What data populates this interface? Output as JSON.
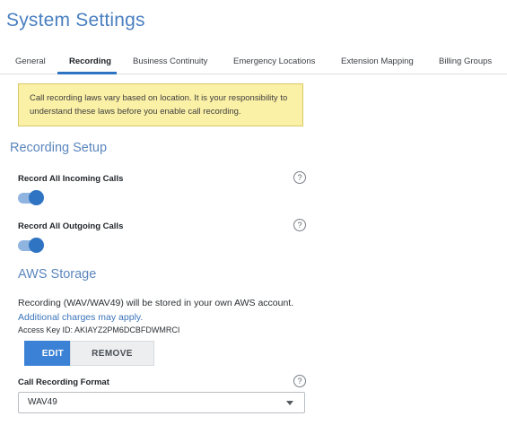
{
  "header": {
    "title": "System Settings"
  },
  "tabs": [
    {
      "label": "General"
    },
    {
      "label": "Recording",
      "active": true
    },
    {
      "label": "Business Continuity"
    },
    {
      "label": "Emergency Locations"
    },
    {
      "label": "Extension Mapping"
    },
    {
      "label": "Billing Groups"
    }
  ],
  "warning": {
    "text": "Call recording laws vary based on location. It is your responsibility to understand these laws before you enable call recording."
  },
  "recording_setup": {
    "title": "Recording Setup",
    "incoming": {
      "label": "Record All Incoming Calls",
      "enabled": true,
      "help_icon": "question-circle-icon"
    },
    "outgoing": {
      "label": "Record All Outgoing Calls",
      "enabled": true,
      "help_icon": "question-circle-icon"
    }
  },
  "aws": {
    "title": "AWS Storage",
    "description": "Recording (WAV/WAV49) will be stored in your own AWS account.",
    "link": "Additional charges may apply.",
    "access_key": "Access Key ID: AKIAYZ2PM6DCBFDWMRCI",
    "edit_label": "EDIT",
    "remove_label": "REMOVE"
  },
  "format": {
    "label": "Call Recording Format",
    "value": "WAV49",
    "help_icon": "question-circle-icon"
  },
  "colors": {
    "accent": "#2f74c3",
    "title": "#4a7fc0",
    "warning_bg": "#fbf1a6"
  }
}
